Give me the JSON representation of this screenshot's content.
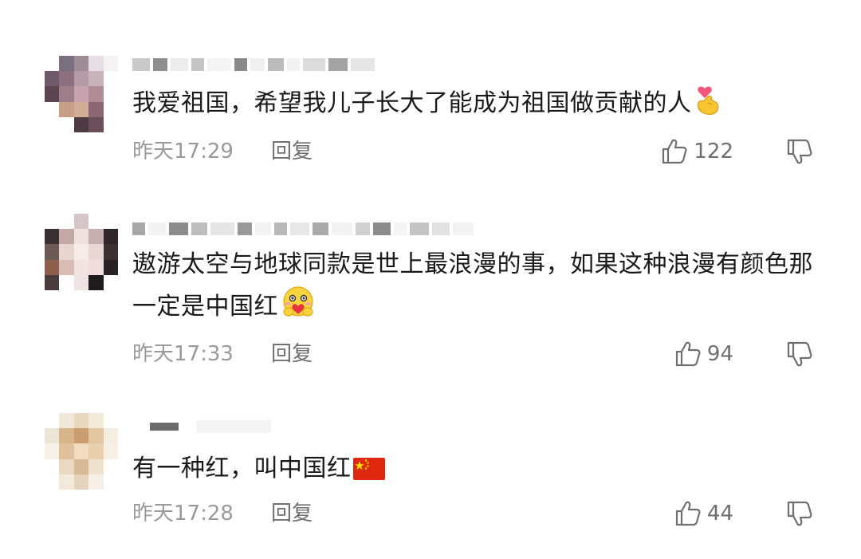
{
  "comments": [
    {
      "text": "我爱祖国，希望我儿子长大了能成为祖国做贡献的人",
      "emoji": "finger-heart-icon",
      "time": "昨天17:29",
      "reply": "回复",
      "likes": "122"
    },
    {
      "text": "遨游太空与地球同款是世上最浪漫的事，如果这种浪漫有颜色那一定是中国红",
      "emoji": "hugging-heart-icon",
      "time": "昨天17:33",
      "reply": "回复",
      "likes": "94"
    },
    {
      "text": "有一种红，叫中国红",
      "emoji": "china-flag-icon",
      "time": "昨天17:28",
      "reply": "回复",
      "likes": "44"
    }
  ],
  "colors": {
    "text": "#1a1a1a",
    "meta": "#9a9a9a",
    "action": "#6f6f6f",
    "flag_red": "#de2910",
    "flag_yellow": "#ffde00"
  }
}
